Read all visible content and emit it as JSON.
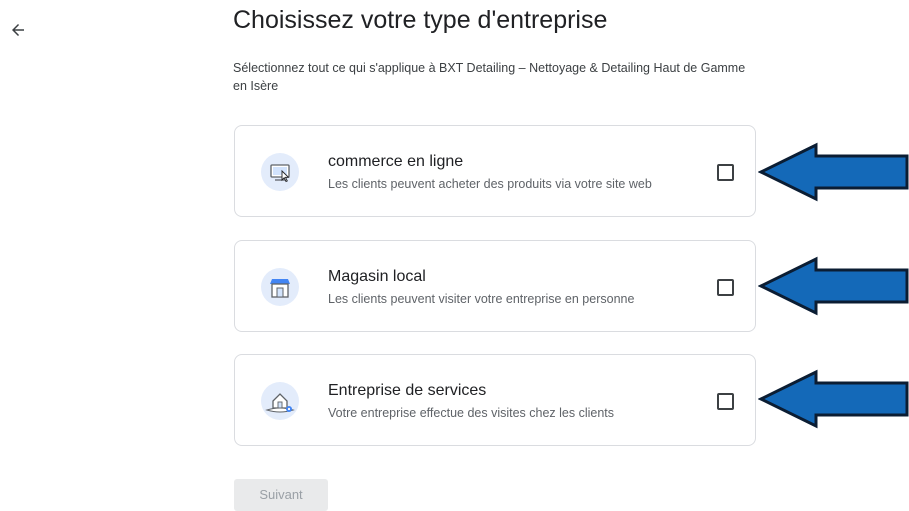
{
  "header": {
    "back_icon": "arrow-left-icon",
    "title": "Choisissez votre type d'entreprise",
    "subtitle": "Sélectionnez tout ce qui s'applique à BXT Detailing – Nettoyage & Detailing Haut de Gamme en Isère"
  },
  "options": [
    {
      "icon": "online-store-icon",
      "title": "commerce en ligne",
      "description": "Les clients peuvent acheter des produits via votre site web",
      "checked": false
    },
    {
      "icon": "local-store-icon",
      "title": "Magasin local",
      "description": "Les clients peuvent visiter votre entreprise en personne",
      "checked": false
    },
    {
      "icon": "service-business-icon",
      "title": "Entreprise de services",
      "description": "Votre entreprise effectue des visites chez les clients",
      "checked": false
    }
  ],
  "annotations": {
    "arrow_color": "#1469b8",
    "arrow_outline": "#0b1d33"
  },
  "footer": {
    "next_label": "Suivant",
    "next_enabled": false
  },
  "colors": {
    "icon_background": "#e3ecfb",
    "icon_accent": "#4285f4",
    "card_border": "#dadce0"
  }
}
